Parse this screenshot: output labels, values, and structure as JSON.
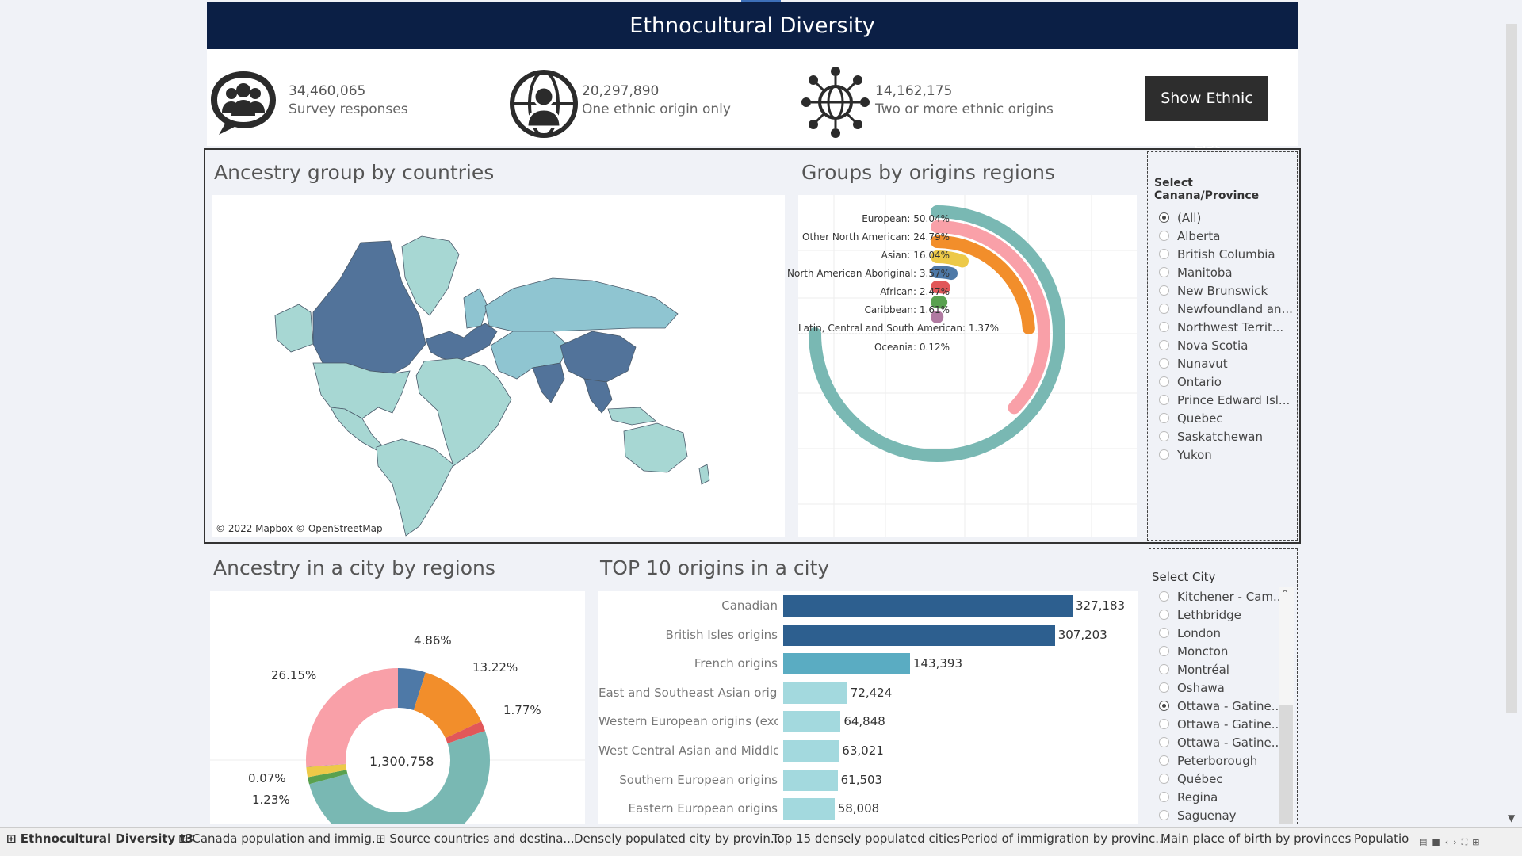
{
  "header": {
    "title": "Ethnocultural Diversity"
  },
  "kpis": [
    {
      "value": "34,460,065",
      "label": "Survey responses",
      "icon": "group-chat-icon"
    },
    {
      "value": "20,297,890",
      "label": "One ethnic origin only",
      "icon": "person-globe-icon"
    },
    {
      "value": "14,162,175",
      "label": "Two or more ethnic origins",
      "icon": "globe-network-icon"
    }
  ],
  "show_list_label": "Show Ethnic List",
  "map_section": {
    "title": "Ancestry group by countries",
    "credit": "© 2022 Mapbox © OpenStreetMap"
  },
  "radial_section": {
    "title": "Groups by origins regions",
    "chart_data": {
      "type": "radial-bar",
      "categories": [
        "European",
        "Other North American",
        "Asian",
        "North American Aboriginal",
        "African",
        "Caribbean",
        "Latin, Central and South American",
        "Oceania"
      ],
      "labels": [
        "European: 50.04%",
        "Other North American: 24.79%",
        "Asian: 16.04%",
        "North American Aboriginal: 3.57%",
        "African: 2.47%",
        "Caribbean: 1.61%",
        "Latin, Central and South American: 1.37%",
        "Oceania: 0.12%"
      ],
      "values": [
        50.04,
        24.79,
        16.04,
        3.57,
        2.47,
        1.61,
        1.37,
        0.12
      ],
      "colors": [
        "#79b8b3",
        "#f9a0a8",
        "#f28e2b",
        "#edc948",
        "#4e79a7",
        "#e15759",
        "#59a14f",
        "#b07aa1"
      ]
    }
  },
  "province_filter": {
    "title": "Select Canana/Province",
    "selected": "(All)",
    "options": [
      "(All)",
      "Alberta",
      "British Columbia",
      "Manitoba",
      "New Brunswick",
      "Newfoundland an...",
      "Northwest Territ...",
      "Nova Scotia",
      "Nunavut",
      "Ontario",
      "Prince Edward Isl...",
      "Quebec",
      "Saskatchewan",
      "Yukon"
    ]
  },
  "donut_section": {
    "title": "Ancestry in a city by regions",
    "center_value": "1,300,758",
    "chart_data": {
      "type": "pie",
      "labels": [
        "4.86%",
        "13.22%",
        "1.77%",
        "26.15%",
        "0.07%",
        "1.23%"
      ],
      "slices": [
        {
          "value": 4.86,
          "color": "#4e79a7",
          "label": "4.86%"
        },
        {
          "value": 13.22,
          "color": "#f28e2b",
          "label": "13.22%"
        },
        {
          "value": 1.77,
          "color": "#e15759",
          "label": "1.77%"
        },
        {
          "value": 50.94,
          "color": "#79b8b3",
          "label": ""
        },
        {
          "value": 1.23,
          "color": "#59a14f",
          "label": "1.23%"
        },
        {
          "value": 1.76,
          "color": "#edc948",
          "label": ""
        },
        {
          "value": 0.07,
          "color": "#b07aa1",
          "label": "0.07%"
        },
        {
          "value": 26.15,
          "color": "#f9a0a8",
          "label": "26.15%"
        }
      ]
    }
  },
  "bar_section": {
    "title": "TOP 10 origins in a city",
    "chart_data": {
      "type": "bar",
      "orientation": "horizontal",
      "categories": [
        "Canadian",
        "British Isles origins",
        "French origins",
        "East and Southeast Asian origi..",
        "Western European origins (exc..",
        "West Central Asian and Middle..",
        "Southern European origins",
        "Eastern European origins"
      ],
      "values": [
        327183,
        307203,
        143393,
        72424,
        64848,
        63021,
        61503,
        58008
      ],
      "value_labels": [
        "327,183",
        "307,203",
        "143,393",
        "72,424",
        "64,848",
        "63,021",
        "61,503",
        "58,008"
      ],
      "colors": [
        "#2d5f8f",
        "#2d5f8f",
        "#5aacc2",
        "#a3d9de",
        "#a3d9de",
        "#a3d9de",
        "#a3d9de",
        "#a3d9de"
      ]
    }
  },
  "city_filter": {
    "title": "Select  City",
    "selected": "Ottawa - Gatine...",
    "options": [
      "Kitchener - Cam...",
      "Lethbridge",
      "London",
      "Moncton",
      "Montréal",
      "Oshawa",
      "Ottawa - Gatine...",
      "Ottawa - Gatine...",
      "Ottawa - Gatine...",
      "Peterborough",
      "Québec",
      "Regina",
      "Saguenay"
    ]
  },
  "tabs": [
    {
      "label": "Ethnocultural Diversity t3",
      "active": true,
      "icon": "grid-icon"
    },
    {
      "label": "Canada population and immig...",
      "icon": "grid-icon"
    },
    {
      "label": "Source countries and destina...",
      "icon": "grid-icon"
    },
    {
      "label": "Densely populated city by provin..."
    },
    {
      "label": "Top 15 densely populated cities"
    },
    {
      "label": "Period of immigration by provinc..."
    },
    {
      "label": "Main place of birth by provinces"
    },
    {
      "label": "Populatio"
    }
  ]
}
